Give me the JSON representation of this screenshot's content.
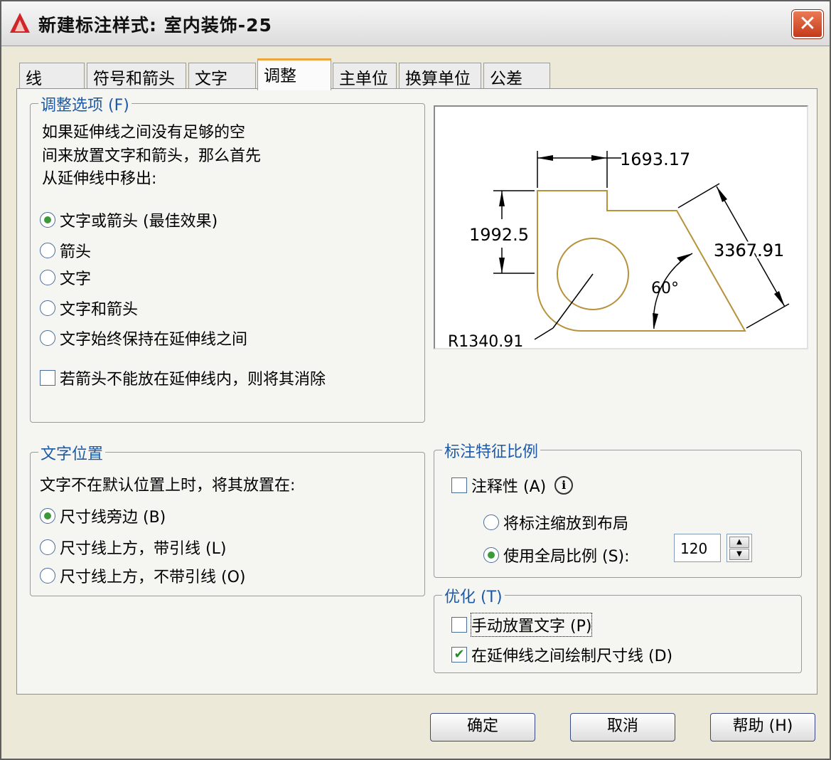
{
  "window": {
    "title": "新建标注样式: 室内装饰-25",
    "close_glyph": "✕"
  },
  "tabs": [
    {
      "label": "线"
    },
    {
      "label": "符号和箭头"
    },
    {
      "label": "文字"
    },
    {
      "label": "调整"
    },
    {
      "label": "主单位"
    },
    {
      "label": "换算单位"
    },
    {
      "label": "公差"
    }
  ],
  "fit_options": {
    "legend": "调整选项 (F)",
    "description": [
      "如果延伸线之间没有足够的空",
      "间来放置文字和箭头，那么首先",
      "从延伸线中移出:"
    ],
    "radios": [
      {
        "label": "文字或箭头 (最佳效果)",
        "selected": true
      },
      {
        "label": "箭头",
        "selected": false
      },
      {
        "label": "文字",
        "selected": false
      },
      {
        "label": "文字和箭头",
        "selected": false
      },
      {
        "label": "文字始终保持在延伸线之间",
        "selected": false
      }
    ],
    "suppress_checkbox": {
      "label": "若箭头不能放在延伸线内，则将其消除",
      "checked": false
    }
  },
  "text_placement": {
    "legend": "文字位置",
    "description": "文字不在默认位置上时，将其放置在:",
    "radios": [
      {
        "label": "尺寸线旁边 (B)",
        "selected": true
      },
      {
        "label": "尺寸线上方，带引线 (L)",
        "selected": false
      },
      {
        "label": "尺寸线上方，不带引线 (O)",
        "selected": false
      }
    ]
  },
  "preview": {
    "dim_top": "1693.17",
    "dim_left": "1992.5",
    "dim_slant": "3367.91",
    "angle": "60°",
    "radius": "R1340.91"
  },
  "scale": {
    "legend": "标注特征比例",
    "annotative": {
      "label": "注释性 (A)",
      "checked": false,
      "info_glyph": "i"
    },
    "radios": [
      {
        "label": "将标注缩放到布局",
        "selected": false
      },
      {
        "label": "使用全局比例 (S):",
        "selected": true
      }
    ],
    "global_value": "120"
  },
  "fine_tuning": {
    "legend": "优化 (T)",
    "checks": [
      {
        "label": "手动放置文字 (P)",
        "checked": false
      },
      {
        "label": "在延伸线之间绘制尺寸线 (D)",
        "checked": true
      }
    ]
  },
  "buttons": {
    "ok": "确定",
    "cancel": "取消",
    "help": "帮助 (H)"
  },
  "colors": {
    "accent": "#1c5aa8",
    "tab_highlight": "#f0a43c",
    "drawing": "#b8923a",
    "close_red": "#d04a28"
  }
}
